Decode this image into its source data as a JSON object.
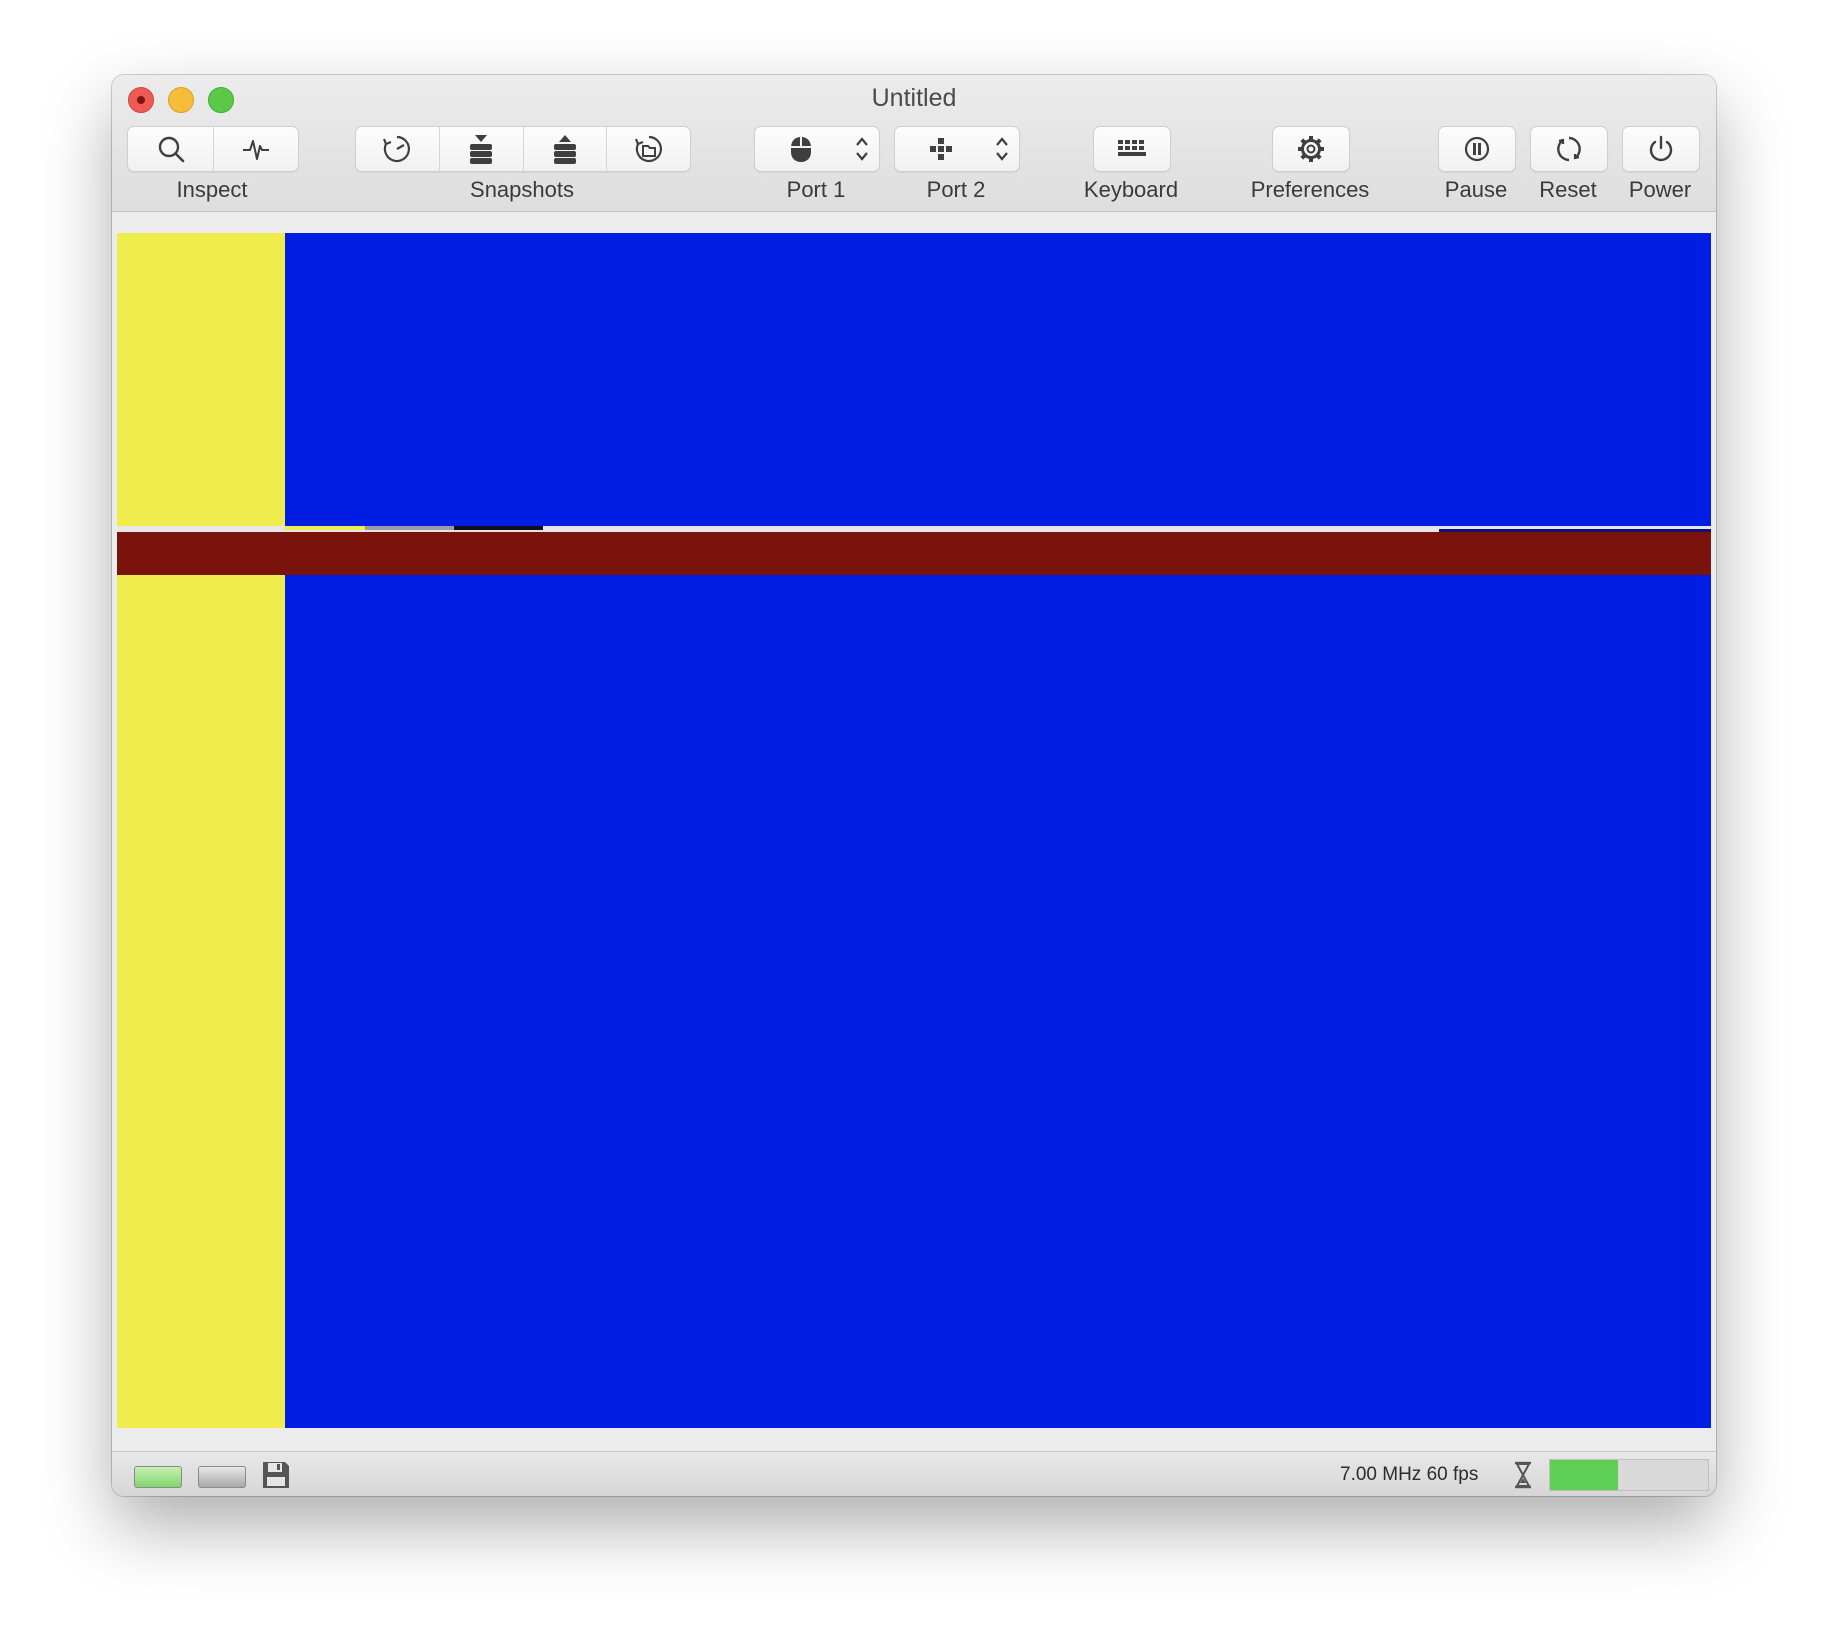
{
  "window": {
    "title": "Untitled"
  },
  "toolbar": {
    "inspect_label": "Inspect",
    "snapshots_label": "Snapshots",
    "port1_label": "Port 1",
    "port2_label": "Port 2",
    "keyboard_label": "Keyboard",
    "preferences_label": "Preferences",
    "pause_label": "Pause",
    "reset_label": "Reset",
    "power_label": "Power",
    "icons": {
      "inspect": [
        "magnifier-icon",
        "waveform-icon"
      ],
      "snapshots": [
        "snapshot-timer-icon",
        "snapshot-take-icon",
        "snapshot-restore-icon",
        "snapshot-browser-icon"
      ],
      "port1": "mouse-icon",
      "port2": "joystick-icon",
      "keyboard": "keyboard-icon",
      "preferences": "gear-icon",
      "pause": "pause-icon",
      "reset": "reset-icon",
      "power": "power-icon"
    }
  },
  "emulator_screen": {
    "colors": {
      "background": "#001ee3",
      "border": "#f0ec4e",
      "band": "#7a130c"
    }
  },
  "status_bar": {
    "info_text": "7.00 MHz 60 fps",
    "drive_icons": [
      "drive-led-active-icon",
      "drive-led-idle-icon",
      "floppy-disk-icon"
    ],
    "speed_icon": "hourglass-icon",
    "speed_level": 0.43,
    "speed_color": "#5fcf55"
  }
}
